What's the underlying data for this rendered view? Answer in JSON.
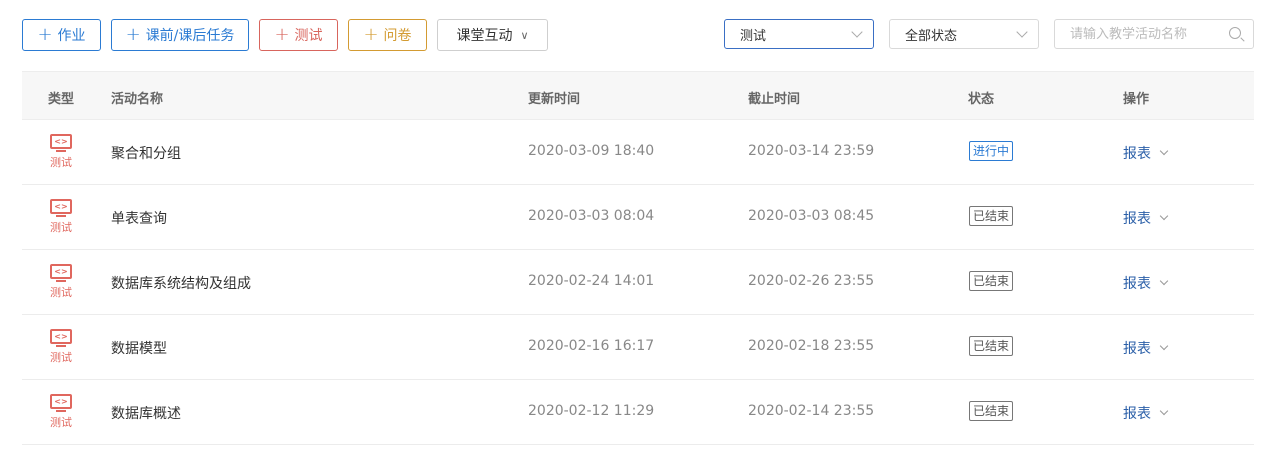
{
  "toolbar": {
    "homework": "作业",
    "pre_post_task": "课前/课后任务",
    "test": "测试",
    "survey": "问卷",
    "classroom_interaction": "课堂互动"
  },
  "filters": {
    "type_value": "测试",
    "status_value": "全部状态",
    "search_placeholder": "请输入教学活动名称"
  },
  "table": {
    "headers": [
      "类型",
      "活动名称",
      "更新时间",
      "截止时间",
      "状态",
      "操作"
    ],
    "rows": [
      {
        "type": "测试",
        "icon": "code-screen-icon",
        "name": "聚合和分组",
        "updated": "2020-03-09 18:40",
        "deadline": "2020-03-14 23:59",
        "status": "进行中",
        "status_kind": "running",
        "action": "报表"
      },
      {
        "type": "测试",
        "icon": "code-screen-icon",
        "name": "单表查询",
        "updated": "2020-03-03 08:04",
        "deadline": "2020-03-03 08:45",
        "status": "已结束",
        "status_kind": "ended",
        "action": "报表"
      },
      {
        "type": "测试",
        "icon": "code-screen-icon",
        "name": "数据库系统结构及组成",
        "updated": "2020-02-24 14:01",
        "deadline": "2020-02-26 23:55",
        "status": "已结束",
        "status_kind": "ended",
        "action": "报表"
      },
      {
        "type": "测试",
        "icon": "code-screen-icon",
        "name": "数据模型",
        "updated": "2020-02-16 16:17",
        "deadline": "2020-02-18 23:55",
        "status": "已结束",
        "status_kind": "ended",
        "action": "报表"
      },
      {
        "type": "测试",
        "icon": "code-screen-icon",
        "name": "数据库概述",
        "updated": "2020-02-12 11:29",
        "deadline": "2020-02-14 23:55",
        "status": "已结束",
        "status_kind": "ended",
        "action": "报表"
      }
    ]
  },
  "colors": {
    "accent_blue": "#2b7bd3",
    "test_red": "#d8655d",
    "survey_orange": "#d39b32",
    "action_link": "#2b5fa8"
  }
}
